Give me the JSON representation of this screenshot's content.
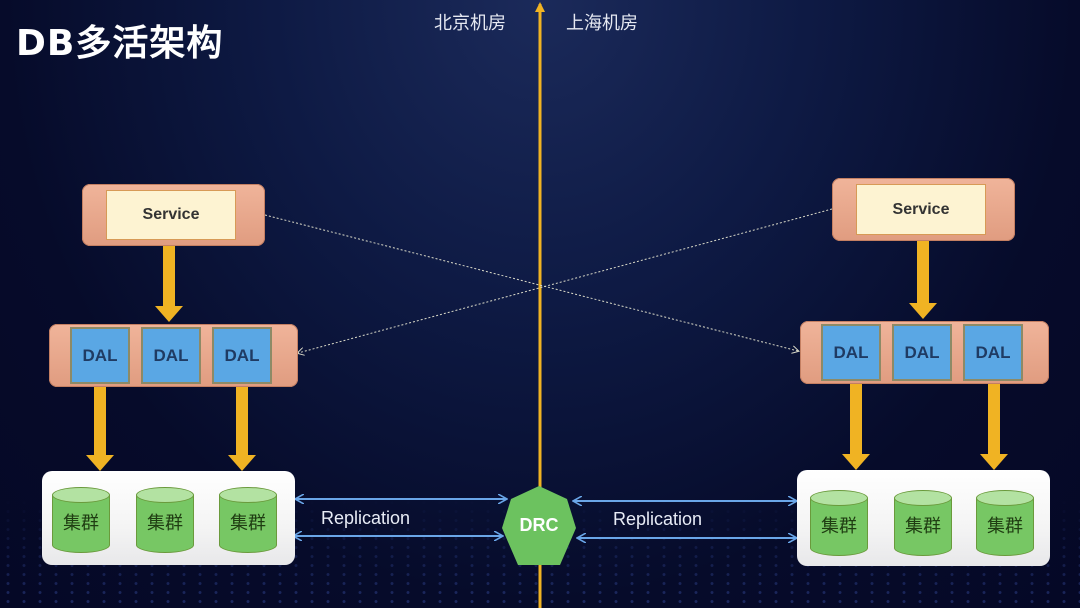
{
  "title": "DB多活架构",
  "datacenters": {
    "left": "北京机房",
    "right": "上海机房"
  },
  "left": {
    "service_label": "Service",
    "dal_labels": [
      "DAL",
      "DAL",
      "DAL"
    ],
    "cluster_labels": [
      "集群",
      "集群",
      "集群"
    ]
  },
  "right": {
    "service_label": "Service",
    "dal_labels": [
      "DAL",
      "DAL",
      "DAL"
    ],
    "cluster_labels": [
      "集群",
      "集群",
      "集群"
    ]
  },
  "center": {
    "drc_label": "DRC",
    "replication_left": "Replication",
    "replication_right": "Replication"
  },
  "colors": {
    "divider": "#f0b323",
    "arrow": "#f0b323",
    "replication_arrow": "#6aa6e8",
    "drc": "#6cc25f",
    "dal": "#5aa7e4",
    "service_container": "#e9a88c",
    "cluster": "#77c764"
  }
}
